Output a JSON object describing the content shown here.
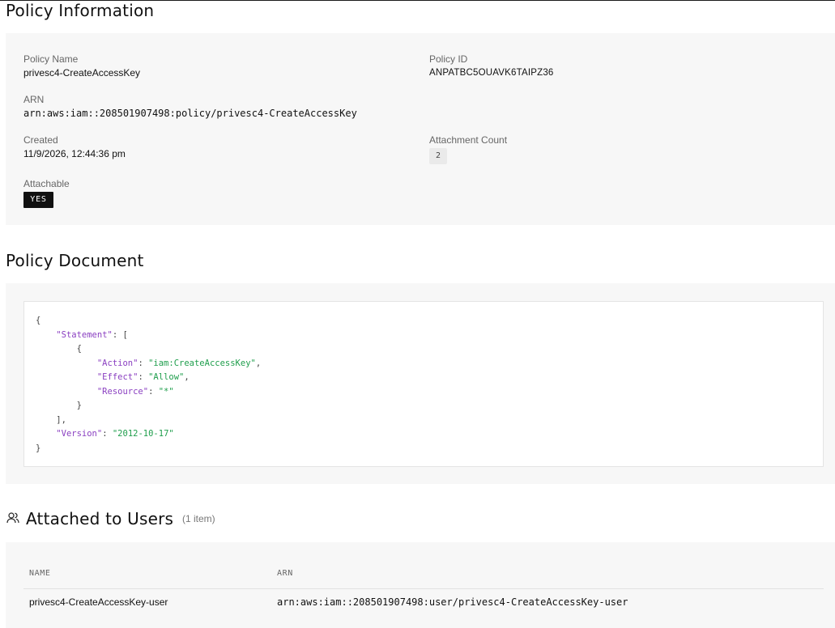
{
  "policy_info": {
    "title": "Policy Information",
    "policy_name_label": "Policy Name",
    "policy_name": "privesc4-CreateAccessKey",
    "policy_id_label": "Policy ID",
    "policy_id": "ANPATBC5OUAVK6TAIPZ36",
    "arn_label": "ARN",
    "arn": "arn:aws:iam::208501907498:policy/privesc4-CreateAccessKey",
    "created_label": "Created",
    "created": "11/9/2026, 12:44:36 pm",
    "attachment_count_label": "Attachment Count",
    "attachment_count": "2",
    "attachable_label": "Attachable",
    "attachable": "YES"
  },
  "policy_document": {
    "title": "Policy Document",
    "lines": [
      [
        {
          "t": "punc",
          "v": "{"
        }
      ],
      [
        {
          "t": "sp",
          "v": "    "
        },
        {
          "t": "key",
          "v": "\"Statement\""
        },
        {
          "t": "punc",
          "v": ": ["
        }
      ],
      [
        {
          "t": "sp",
          "v": "        "
        },
        {
          "t": "punc",
          "v": "{"
        }
      ],
      [
        {
          "t": "sp",
          "v": "            "
        },
        {
          "t": "key",
          "v": "\"Action\""
        },
        {
          "t": "punc",
          "v": ": "
        },
        {
          "t": "str",
          "v": "\"iam:CreateAccessKey\""
        },
        {
          "t": "punc",
          "v": ","
        }
      ],
      [
        {
          "t": "sp",
          "v": "            "
        },
        {
          "t": "key",
          "v": "\"Effect\""
        },
        {
          "t": "punc",
          "v": ": "
        },
        {
          "t": "str",
          "v": "\"Allow\""
        },
        {
          "t": "punc",
          "v": ","
        }
      ],
      [
        {
          "t": "sp",
          "v": "            "
        },
        {
          "t": "key",
          "v": "\"Resource\""
        },
        {
          "t": "punc",
          "v": ": "
        },
        {
          "t": "str",
          "v": "\"*\""
        }
      ],
      [
        {
          "t": "sp",
          "v": "        "
        },
        {
          "t": "punc",
          "v": "}"
        }
      ],
      [
        {
          "t": "sp",
          "v": "    "
        },
        {
          "t": "punc",
          "v": "],"
        }
      ],
      [
        {
          "t": "sp",
          "v": "    "
        },
        {
          "t": "key",
          "v": "\"Version\""
        },
        {
          "t": "punc",
          "v": ": "
        },
        {
          "t": "str",
          "v": "\"2012-10-17\""
        }
      ],
      [
        {
          "t": "punc",
          "v": "}"
        }
      ]
    ]
  },
  "attached_users": {
    "icon": "users-icon",
    "title": "Attached to Users",
    "count_label": "(1 item)",
    "columns": [
      "NAME",
      "ARN"
    ],
    "rows": [
      {
        "name": "privesc4-CreateAccessKey-user",
        "arn": "arn:aws:iam::208501907498:user/privesc4-CreateAccessKey-user"
      }
    ]
  },
  "colors": {
    "json_key": "#8a3fc1",
    "json_string": "#1f9e4c",
    "panel_bg": "#f7f7f7",
    "badge_dark": "#111111"
  }
}
